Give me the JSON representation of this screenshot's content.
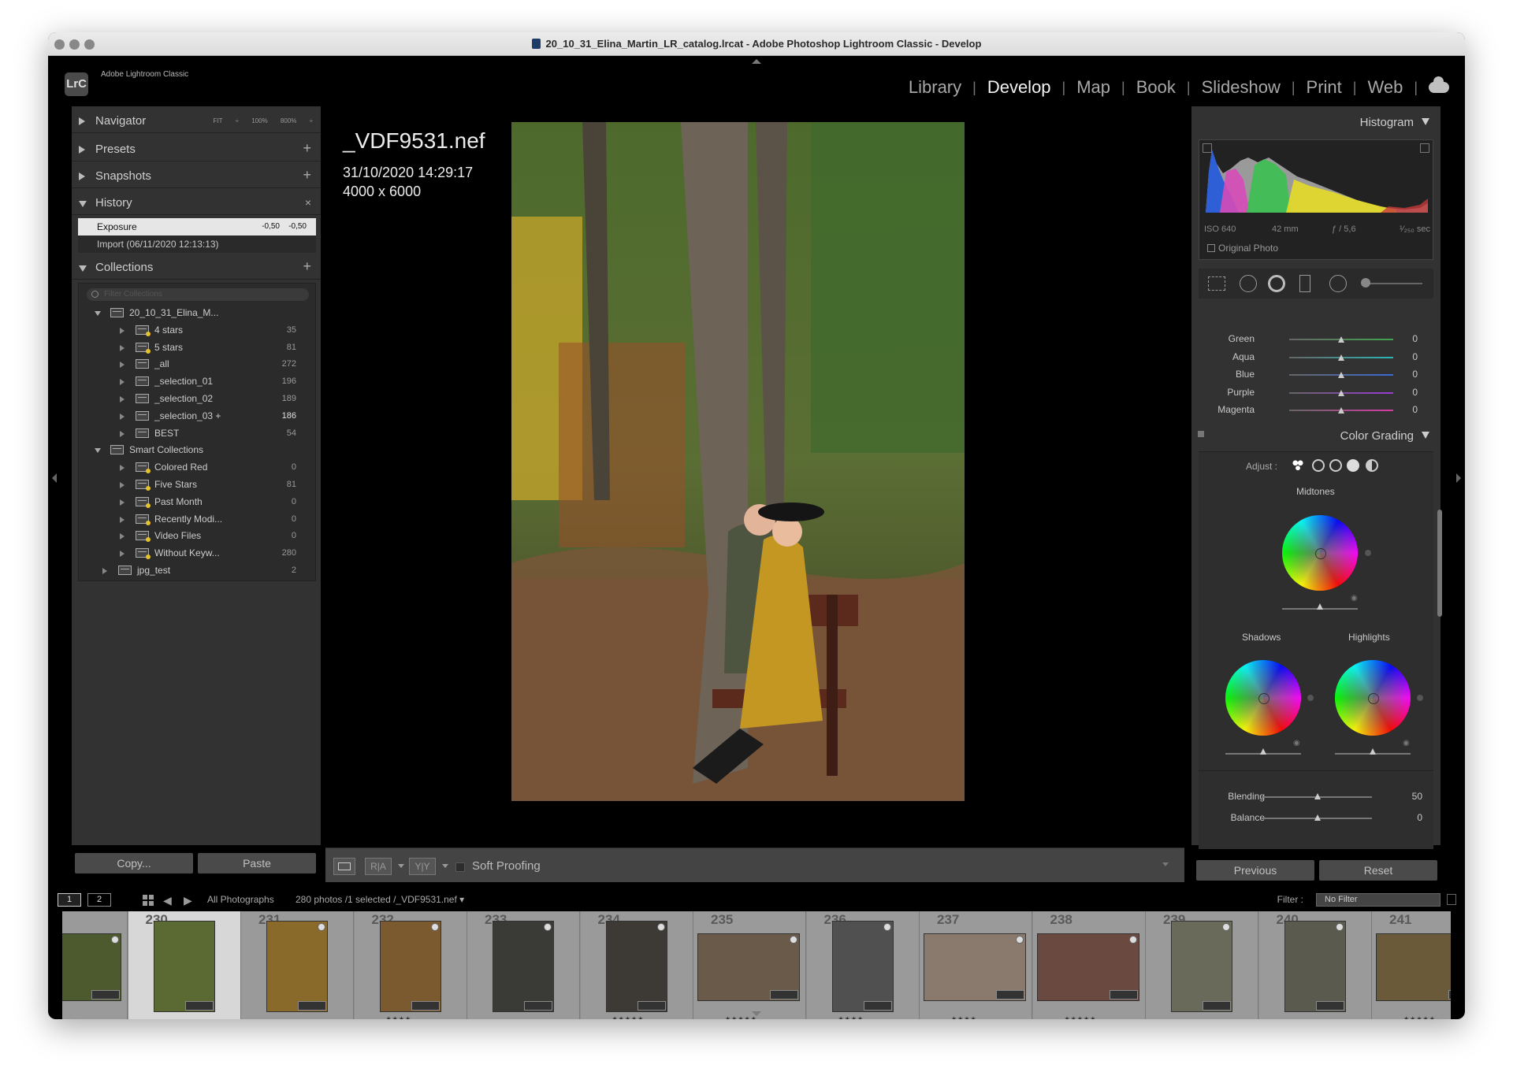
{
  "window": {
    "title": "20_10_31_Elina_Martin_LR_catalog.lrcat - Adobe Photoshop Lightroom Classic - Develop",
    "traffic_color": "#888888"
  },
  "app": {
    "logo": "LrC",
    "name": "Adobe Lightroom Classic"
  },
  "modules": [
    "Library",
    "Develop",
    "Map",
    "Book",
    "Slideshow",
    "Print",
    "Web"
  ],
  "active_module": "Develop",
  "left_panel": {
    "navigator": {
      "label": "Navigator",
      "zoom": "FIT ÷   100%   800% ÷"
    },
    "presets": {
      "label": "Presets"
    },
    "snapshots": {
      "label": "Snapshots"
    },
    "history": {
      "label": "History",
      "items": [
        {
          "name": "Exposure",
          "v1": "-0,50",
          "v2": "-0,50"
        },
        {
          "name": "Import (06/11/2020 12:13:13)"
        }
      ]
    },
    "collections": {
      "label": "Collections",
      "filter_placeholder": "Filter Collections",
      "items": [
        {
          "name": "20_10_31_Elina_M...",
          "count": ""
        },
        {
          "name": "4 stars",
          "count": "35"
        },
        {
          "name": "5 stars",
          "count": "81"
        },
        {
          "name": "_all",
          "count": "272"
        },
        {
          "name": "_selection_01",
          "count": "196"
        },
        {
          "name": "_selection_02",
          "count": "189"
        },
        {
          "name": "_selection_03  +",
          "count": "186"
        },
        {
          "name": "BEST",
          "count": "54"
        },
        {
          "name": "Smart Collections",
          "count": ""
        },
        {
          "name": "Colored Red",
          "count": "0"
        },
        {
          "name": "Five Stars",
          "count": "81"
        },
        {
          "name": "Past Month",
          "count": "0"
        },
        {
          "name": "Recently Modi...",
          "count": "0"
        },
        {
          "name": "Video Files",
          "count": "0"
        },
        {
          "name": "Without Keyw...",
          "count": "280"
        },
        {
          "name": "jpg_test",
          "count": "2"
        }
      ]
    },
    "copy_button": "Copy...",
    "paste_button": "Paste"
  },
  "photo_info": {
    "filename": "_VDF9531.nef",
    "datetime": "31/10/2020 14:29:17",
    "dimensions": "4000 x 6000"
  },
  "toolbar": {
    "soft_proofing": "Soft Proofing",
    "before_after": "R|A",
    "yy": "Y|Y"
  },
  "right_panel": {
    "histogram": {
      "label": "Histogram",
      "iso": "ISO 640",
      "focal": "42 mm",
      "aperture": "ƒ / 5,6",
      "shutter": "¹⁄₂₅₀ sec",
      "original_photo": "Original Photo"
    },
    "hsl": [
      {
        "name": "Green",
        "value": "0",
        "color": "#3fa34d"
      },
      {
        "name": "Aqua",
        "value": "0",
        "color": "#2bb5b5"
      },
      {
        "name": "Blue",
        "value": "0",
        "color": "#3a6ad6"
      },
      {
        "name": "Purple",
        "value": "0",
        "color": "#9a3ad6"
      },
      {
        "name": "Magenta",
        "value": "0",
        "color": "#d63aa6"
      }
    ],
    "color_grading": {
      "label": "Color Grading",
      "adjust": "Adjust :",
      "midtones": "Midtones",
      "shadows": "Shadows",
      "highlights": "Highlights",
      "blending_label": "Blending",
      "blending_value": "50",
      "balance_label": "Balance",
      "balance_value": "0"
    },
    "previous_button": "Previous",
    "reset_button": "Reset"
  },
  "filmstrip_bar": {
    "page1": "1",
    "page2": "2",
    "source": "All Photographs",
    "status": "280 photos /1 selected /_VDF9531.nef ▾",
    "filter_label": "Filter :",
    "filter_value": "No Filter"
  },
  "filmstrip": [
    {
      "index": "",
      "stars": ""
    },
    {
      "index": "230",
      "stars": "",
      "selected": true
    },
    {
      "index": "231",
      "stars": ""
    },
    {
      "index": "232",
      "stars": "★★★★"
    },
    {
      "index": "233",
      "stars": ""
    },
    {
      "index": "234",
      "stars": "★★★★★"
    },
    {
      "index": "235",
      "stars": "★★★★★"
    },
    {
      "index": "236",
      "stars": "★★★★"
    },
    {
      "index": "237",
      "stars": "★★★★"
    },
    {
      "index": "238",
      "stars": "★★★★★"
    },
    {
      "index": "239",
      "stars": ""
    },
    {
      "index": "240",
      "stars": ""
    },
    {
      "index": "241",
      "stars": "★★★★★"
    }
  ]
}
